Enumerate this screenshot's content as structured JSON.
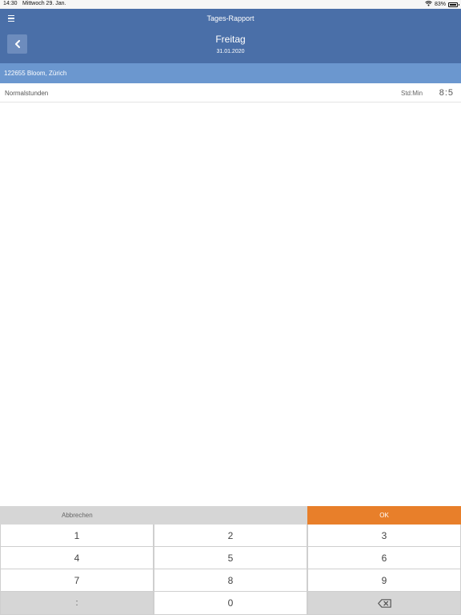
{
  "status_bar": {
    "time": "14:30",
    "date": "Mittwoch 29. Jan.",
    "battery": "83%",
    "battery_level": 0.83
  },
  "header": {
    "app_title": "Tages-Rapport",
    "day": "Freitag",
    "date": "31.01.2020"
  },
  "project": {
    "label": "122655 Bloom, Zürich"
  },
  "hours": {
    "label": "Normalstunden",
    "unit": "Std:Min",
    "value": "8:5"
  },
  "keypad": {
    "cancel_label": "Abbrechen",
    "ok_label": "OK",
    "keys": [
      "1",
      "2",
      "3",
      "4",
      "5",
      "6",
      "7",
      "8",
      "9",
      ":",
      "0"
    ]
  },
  "colors": {
    "header": "#4a6fa8",
    "project_bar": "#6b97cf",
    "ok_button": "#e87f2a"
  }
}
